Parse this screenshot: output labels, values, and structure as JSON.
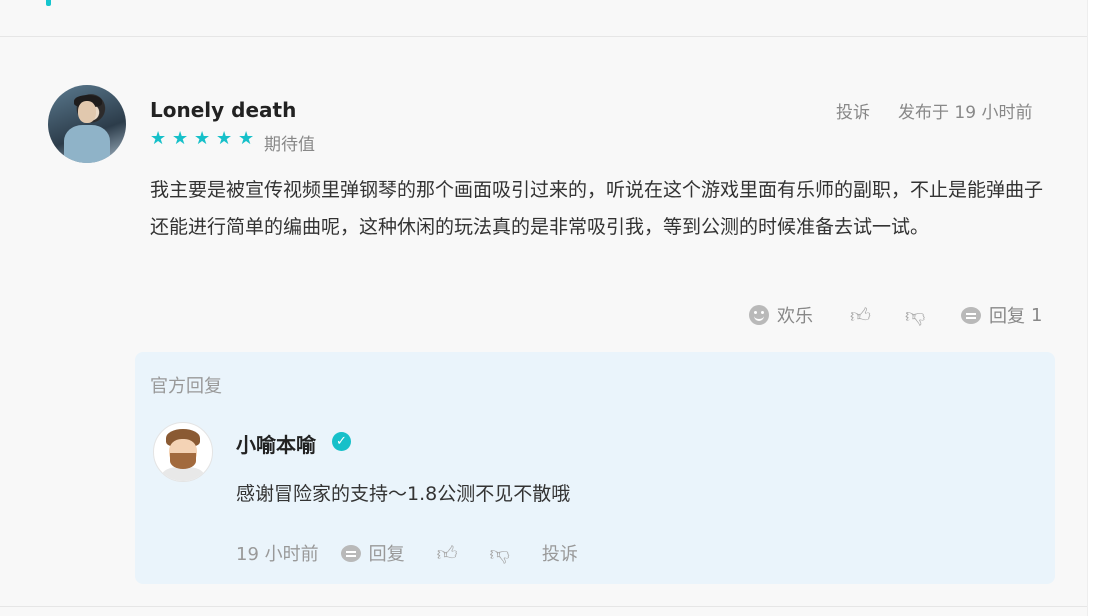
{
  "topbar": {
    "faded_text": "",
    "faded_right": ""
  },
  "review": {
    "username": "Lonely death",
    "stars": 5,
    "rating_label": "期待值",
    "report_label": "投诉",
    "posted": "发布于 19 小时前",
    "content": "我主要是被宣传视频里弹钢琴的那个画面吸引过来的，听说在这个游戏里面有乐师的副职，不止是能弹曲子还能进行简单的编曲呢，这种休闲的玩法真的是非常吸引我，等到公测的时候准备去试一试。",
    "actions": {
      "reaction_label": "欢乐",
      "reply_label": "回复",
      "reply_count": "1"
    }
  },
  "official_reply": {
    "section_label": "官方回复",
    "name": "小喻本喻",
    "verified_mark": "✓",
    "text": "感谢冒险家的支持～1.8公测不见不散哦",
    "time": "19 小时前",
    "reply_label": "回复",
    "report_label": "投诉"
  },
  "colors": {
    "accent": "#16c0c9",
    "reply_bg": "#eaf4fb",
    "page_bg": "#f8f8f8"
  }
}
